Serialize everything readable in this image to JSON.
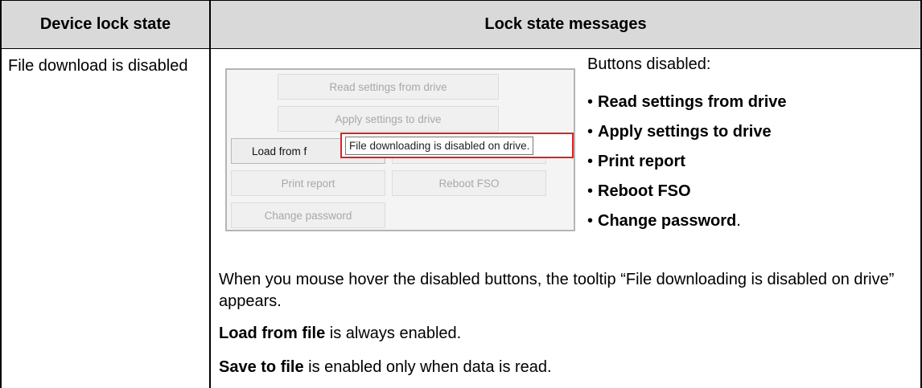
{
  "table": {
    "headers": [
      "Device lock state",
      "Lock state messages"
    ]
  },
  "row": {
    "state": "File download is disabled",
    "screenshot": {
      "buttons": {
        "read_settings": "Read settings from drive",
        "apply_settings": "Apply settings to drive",
        "load_from_file": "Load from f",
        "print_report": "Print report",
        "reboot_fso": "Reboot FSO",
        "change_password": "Change password"
      },
      "tooltip": "File downloading is disabled on drive."
    },
    "buttons_disabled_heading": "Buttons disabled:",
    "disabled_buttons": [
      {
        "bullet": "•",
        "label": "Read settings from drive",
        "suffix": ""
      },
      {
        "bullet": "•",
        "label": "Apply settings to drive",
        "suffix": ""
      },
      {
        "bullet": "•",
        "label": "Print report",
        "suffix": ""
      },
      {
        "bullet": "•",
        "label": "Reboot FSO",
        "suffix": ""
      },
      {
        "bullet": "•",
        "label": "Change password",
        "suffix": "."
      }
    ],
    "hover_note": "When you mouse hover the disabled buttons, the tooltip “File downloading is disabled on drive” appears.",
    "load_note": {
      "bold": "Load from file",
      "rest": " is always enabled."
    },
    "save_note": {
      "bold": "Save to file",
      "rest": " is enabled only when data is read."
    }
  },
  "colors": {
    "header_bg": "#d9d9d9",
    "tooltip_border": "#e02020"
  }
}
